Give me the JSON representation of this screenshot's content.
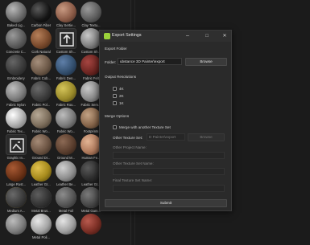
{
  "library": {
    "materials": [
      {
        "label": "Baked Lig...",
        "fill": "radial-gradient(circle at 35% 35%, #b9b9b9, #6c6c6c 55%, #2e2e2e)"
      },
      {
        "label": "Carbon Fiber",
        "fill": "radial-gradient(circle at 35% 35%, #5a5a5a, #141414 60%, #050505)"
      },
      {
        "label": "Clay Sertie...",
        "fill": "radial-gradient(circle at 35% 35%, #c89a82, #8c5c48 55%, #3e261d)"
      },
      {
        "label": "Clay Textu...",
        "fill": "radial-gradient(circle at 35% 35%, #9a9a9a, #5e5e5e 55%, #262626)"
      },
      {
        "label": "Concrete C...",
        "fill": "radial-gradient(circle at 35% 35%, #9a9a9a, #5c5c5c 55%, #2a2a2a)"
      },
      {
        "label": "Cork Natural",
        "fill": "radial-gradient(circle at 35% 35%, #b6805a, #7a4a2c 55%, #35200f)"
      },
      {
        "label": "Custom Sh...",
        "icon": "up-arrow-tile-icon"
      },
      {
        "label": "Custom Sh...",
        "fill": "radial-gradient(circle at 35% 35%, #c9c9c9, #7e7e7e 55%, #333333)"
      },
      {
        "label": "Embroidery",
        "fill": "radial-gradient(circle at 35% 35%, #666666, #3a3a3a 55%, #191919)"
      },
      {
        "label": "Fabric Cob...",
        "fill": "radial-gradient(circle at 35% 35%, #a58f7c, #6e5a49 55%, #2e241b)"
      },
      {
        "label": "Fabric Den...",
        "fill": "radial-gradient(circle at 35% 35%, #5f7fa8, #34506f 55%, #142030)"
      },
      {
        "label": "Fabric Felt",
        "fill": "radial-gradient(circle at 35% 35%, #a54541, #6e2622 55%, #2e0f0d)"
      },
      {
        "label": "Fabric Nylon",
        "fill": "radial-gradient(circle at 35% 35%, #c0c0c0, #7d7d7d 55%, #323232)"
      },
      {
        "label": "Fabric Pol...",
        "fill": "radial-gradient(circle at 35% 35%, #6a6a6a, #3c3c3c 55%, #171717)"
      },
      {
        "label": "Fabric Rou...",
        "fill": "radial-gradient(circle at 35% 35%, #d4c45a, #9a8a2a 55%, #3e360f)"
      },
      {
        "label": "Fabric Sem...",
        "fill": "radial-gradient(circle at 35% 35%, #c9c9c9, #8a8a8a 55%, #3a3a3a)"
      },
      {
        "label": "Fabric Tex...",
        "fill": "radial-gradient(circle at 35% 35%, #ffffff, #bcbcbc 45%, #5e5e5e)"
      },
      {
        "label": "Fabric Wo...",
        "fill": "radial-gradient(circle at 35% 35%, #b7a996, #7d6e5c 55%, #342c22)"
      },
      {
        "label": "Fabric Wo...",
        "fill": "radial-gradient(circle at 35% 35%, #bdbdbd, #7a7a7a 55%, #303030)"
      },
      {
        "label": "Footprints",
        "fill": "radial-gradient(circle at 35% 35%, #c2a284, #86654a 55%, #3a2a1d)"
      },
      {
        "label": "Graphic In...",
        "icon": "image-tile-icon"
      },
      {
        "label": "Ground Dr...",
        "fill": "radial-gradient(circle at 35% 35%, #a58b77, #6c5443 55%, #2d2119)"
      },
      {
        "label": "Ground M...",
        "fill": "radial-gradient(circle at 35% 35%, #8c6a55, #5a3e2e 55%, #241811)"
      },
      {
        "label": "Human Fe...",
        "fill": "radial-gradient(circle at 35% 35%, #e2b494, #b07a5c 55%, #4a2f22)"
      },
      {
        "label": "Large Rust...",
        "fill": "radial-gradient(circle at 35% 35%, #a85a34, #6c3216 55%, #2c1206)"
      },
      {
        "label": "Leather Gr...",
        "fill": "radial-gradient(circle at 35% 35%, #e0c14e, #a68a1c 55%, #443808)"
      },
      {
        "label": "Leather Be...",
        "fill": "radial-gradient(circle at 35% 35%, #d0d0d0, #8e8e8e 55%, #3a3a3a)"
      },
      {
        "label": "Leather Gr...",
        "fill": "radial-gradient(circle at 35% 35%, #5a5a5a, #2e2e2e 55%, #121212)"
      },
      {
        "label": "Medium A...",
        "fill": "radial-gradient(circle at 35% 35%, #f0c64e, #b38a1c 55%, #4a380a)"
      },
      {
        "label": "Metal Brus...",
        "fill": "radial-gradient(circle at 35% 35%, #dcdcdc, #9a9a9a 55%, #454545)"
      },
      {
        "label": "Metal Foil",
        "fill": "radial-gradient(circle at 35% 35%, #ececec, #a8a8a8 50%, #484848)"
      },
      {
        "label": "Metal Gam...",
        "fill": "radial-gradient(circle at 35% 35%, #d8d8d8, #959595 55%, #404040)"
      },
      {
        "label": "",
        "fill": "radial-gradient(circle at 35% 35%, #d0d0d0, #8e8e8e 55%, #3a3a3a)"
      },
      {
        "label": "",
        "fill": "radial-gradient(circle at 35% 35%, #c6b6a0, #8a7a66 55%, #3c3428)"
      },
      {
        "label": "",
        "fill": "radial-gradient(circle at 35% 35%, #e4e4e4, #a0a0a0 55%, #444444)"
      },
      {
        "label": "",
        "fill": "radial-gradient(circle at 35% 35%, #b85a4e, #7a2e24 55%, #30100c)"
      }
    ],
    "extra": [
      {
        "label": "",
        "fill": "radial-gradient(circle at 35% 35%, #6a6a6a, #3a3a3a 55%, #161616)"
      },
      {
        "label": "",
        "fill": "radial-gradient(circle at 35% 35%, #5e5e5e, #333333 55%, #141414)"
      },
      {
        "label": "",
        "fill": "radial-gradient(circle at 35% 35%, #8c8c8c, #555555 55%, #222222)"
      },
      {
        "label": "",
        "fill": "radial-gradient(circle at 35% 35%, #7a7a7a, #474747 55%, #1c1c1c)"
      },
      {
        "label": "",
        "fill": "radial-gradient(circle at 35% 35%, #6e6e6e, #404040 55%, #1a1a1a)"
      },
      {
        "label": "",
        "fill": "radial-gradient(circle at 35% 35%, #bcbcbc, #7c7c7c 55%, #323232)"
      },
      {
        "label": "Metal Poli...",
        "fill": "radial-gradient(circle at 35% 35%, #e8e8e8, #a4a4a4 55%, #464646)"
      }
    ]
  },
  "dialog": {
    "title": "Export Settings",
    "minimize_glyph": "–",
    "maximize_glyph": "□",
    "close_glyph": "✕",
    "export_folder_heading": "Export Folder",
    "folder_label": "Folder:",
    "folder_value": "ubstance 3D Painter\\export",
    "browse_label": "Browse",
    "resolutions_heading": "Output Resolutions",
    "resolutions": [
      "4K",
      "2K",
      "1K"
    ],
    "merge_heading": "Merge Options",
    "merge_checkbox_label": "Merge with another Texture Set",
    "other_texture_label": "Other Texture Set:",
    "other_texture_value": "D Painter\\export",
    "browse2_label": "Browse",
    "other_project_label": "Other Project Name:",
    "other_texture_name_label": "Other Texture Set Name:",
    "final_texture_name_label": "Final Texture Set Name:",
    "submit_label": "Submit"
  },
  "colors": {
    "accent": "#9bd23a",
    "dialog_bg": "#2a2a2a",
    "app_bg": "#1d1d1d"
  }
}
